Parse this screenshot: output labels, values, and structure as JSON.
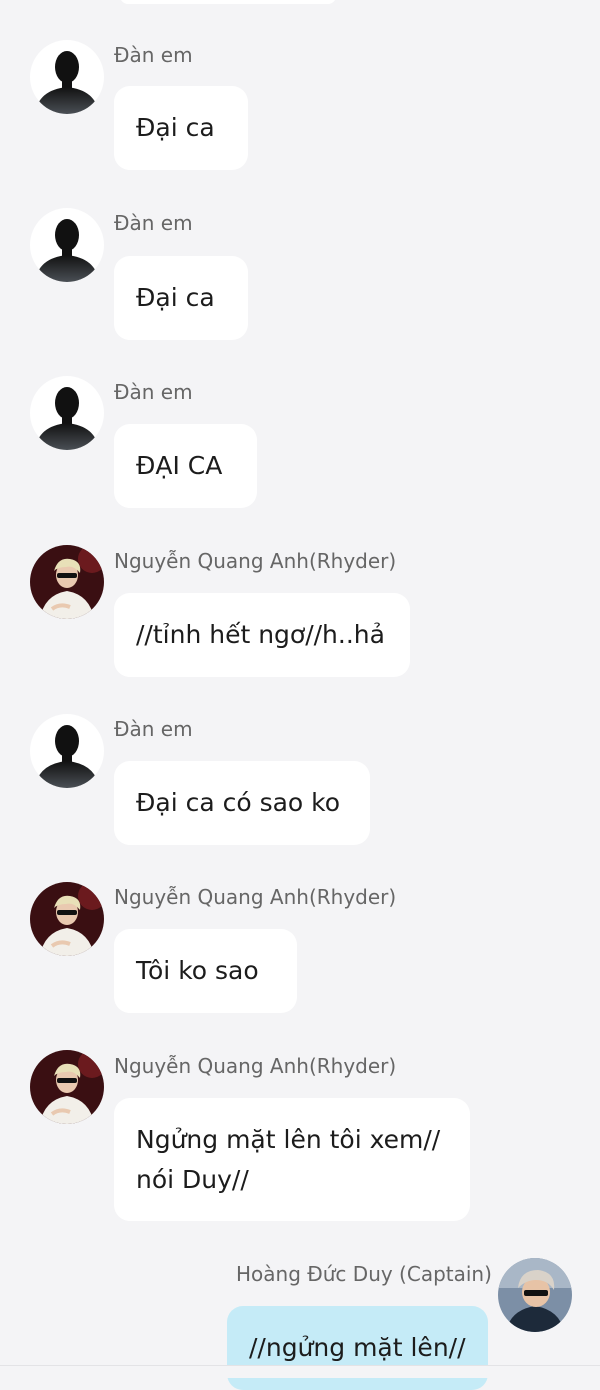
{
  "messages": [
    {
      "sender": "Đàn em",
      "text": "Đại ca",
      "avatar": "silhouette-avatar",
      "side": "left"
    },
    {
      "sender": "Đàn em",
      "text": "Đại ca",
      "avatar": "silhouette-avatar",
      "side": "left"
    },
    {
      "sender": "Đàn em",
      "text": "ĐẠI CA",
      "avatar": "silhouette-avatar",
      "side": "left"
    },
    {
      "sender": "Nguyễn Quang Anh(Rhyder)",
      "text": "//tỉnh hết ngơ//h..hả",
      "avatar": "photo-avatar-rhyder",
      "side": "left"
    },
    {
      "sender": "Đàn em",
      "text": "Đại ca có sao ko",
      "avatar": "silhouette-avatar",
      "side": "left"
    },
    {
      "sender": "Nguyễn Quang Anh(Rhyder)",
      "text": "Tôi ko sao",
      "avatar": "photo-avatar-rhyder",
      "side": "left"
    },
    {
      "sender": "Nguyễn Quang Anh(Rhyder)",
      "text": "Ngửng mặt lên tôi xem//\nnói Duy//",
      "avatar": "photo-avatar-rhyder",
      "side": "left"
    },
    {
      "sender": "Hoàng Đức Duy (Captain)",
      "text": "//ngửng mặt lên//",
      "avatar": "photo-avatar-captain",
      "side": "right"
    }
  ],
  "colors": {
    "background": "#f4f4f6",
    "incoming_bubble": "#ffffff",
    "outgoing_bubble": "#c5ebf7"
  }
}
